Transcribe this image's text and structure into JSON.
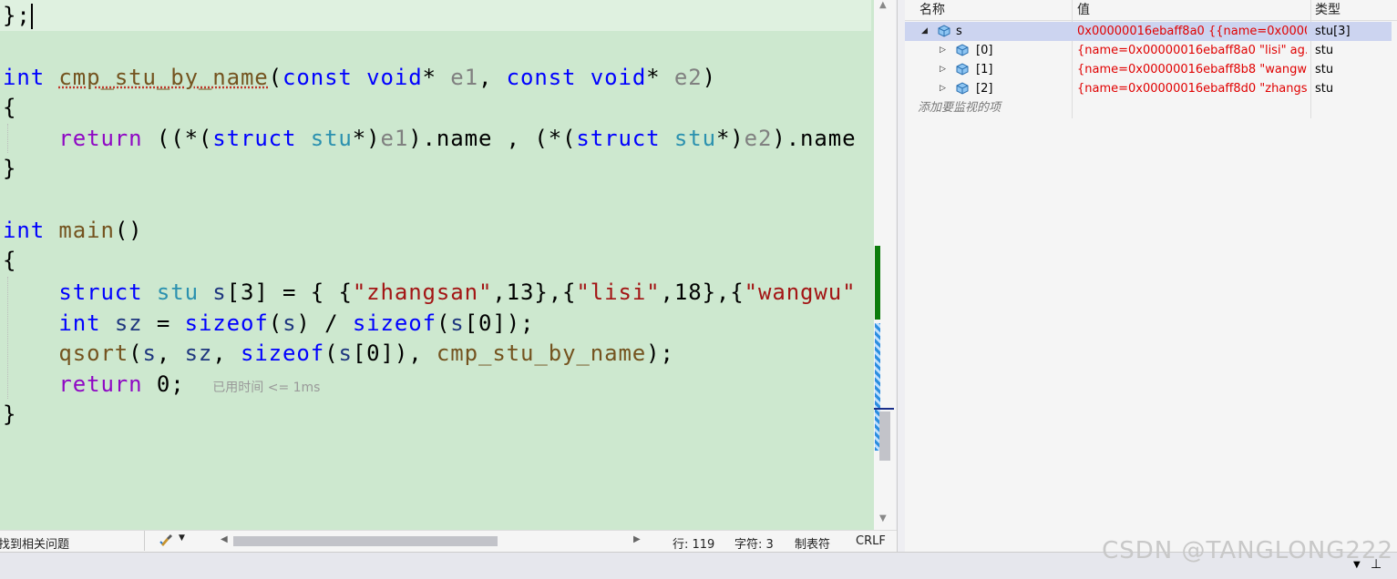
{
  "editor": {
    "hint_time": "已用时间 <= 1ms"
  },
  "status": {
    "issues": "找到相关问题",
    "line": "行: 119",
    "col": "字符: 3",
    "tab": "制表符",
    "eol": "CRLF"
  },
  "watch": {
    "headers": {
      "name": "名称",
      "value": "值",
      "type": "类型"
    },
    "rows": [
      {
        "name": "s",
        "value": "0x00000016ebaff8a0 {{name=0x0000...",
        "type": "stu[3]"
      },
      {
        "name": "[0]",
        "value": "{name=0x00000016ebaff8a0 \"lisi\" ag...",
        "type": "stu"
      },
      {
        "name": "[1]",
        "value": "{name=0x00000016ebaff8b8 \"wangw...",
        "type": "stu"
      },
      {
        "name": "[2]",
        "value": "{name=0x00000016ebaff8d0 \"zhangs...",
        "type": "stu"
      }
    ],
    "add_placeholder": "添加要监视的项"
  },
  "watermark": "CSDN @TANGLONG222",
  "colors": {
    "editor_bg": "#cde8cf",
    "value_red": "#e00000",
    "keyword": "#0000ff"
  },
  "icons": [
    "expand-triangle-icon",
    "struct-cube-icon",
    "brush-icon",
    "pin-icon"
  ]
}
